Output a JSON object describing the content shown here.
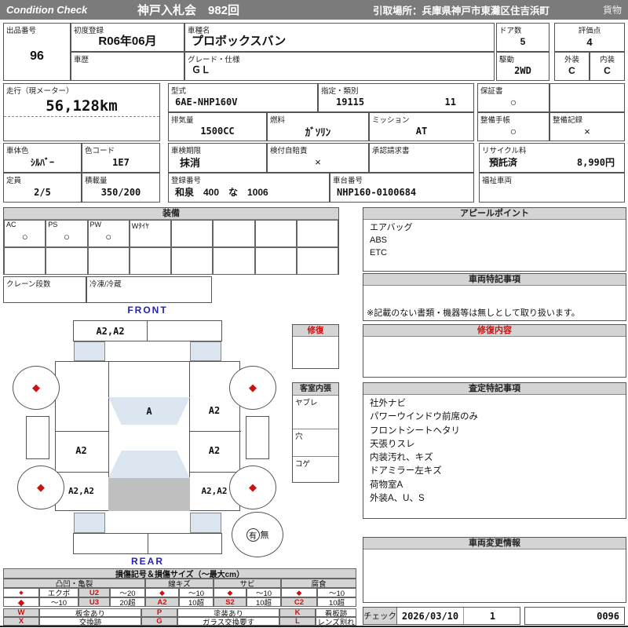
{
  "header": {
    "brand": "Condition  Check",
    "auction_title": "神戸入札会　982回",
    "pickup_location": "引取場所：兵庫県神戸市東灘区住吉浜町",
    "category": "貨物"
  },
  "info": {
    "lot_label": "出品番号",
    "lot_no": "96",
    "first_reg_label": "初度登録",
    "first_reg": "R06年06月",
    "history_label": "車歴",
    "history": "",
    "model_name_label": "車種名",
    "model_name": "プロボックスバン",
    "grade_label": "グレード・仕様",
    "grade": "ＧＬ",
    "doors_label": "ドア数",
    "doors": "5",
    "drive_label": "駆動",
    "drive": "2WD",
    "score_label": "評価点",
    "score": "4",
    "exterior_label": "外装",
    "exterior": "C",
    "interior_label": "内装",
    "interior": "C",
    "mileage_label": "走行（現メーター）",
    "mileage": "56,128km",
    "model_code_label": "型式",
    "model_code": "6AE-NHP160V",
    "class_label": "指定・類別",
    "class_no": "19115",
    "class_sub": "11",
    "warranty_label": "保証書",
    "warranty": "○",
    "displacement_label": "排気量",
    "displacement": "1500CC",
    "fuel_label": "燃料",
    "fuel": "ｶﾞｿﾘﾝ",
    "mission_label": "ミッション",
    "mission": "AT",
    "maintenance_book_label": "整備手帳",
    "maintenance_book": "○",
    "maintenance_record_label": "整備記録",
    "maintenance_record": "×",
    "body_color_label": "車体色",
    "body_color": "ｼﾙﾊﾞｰ",
    "color_code_label": "色コード",
    "color_code": "1E7",
    "inspection_label": "車検期限",
    "inspection": "抹消",
    "insurance_label": "検付自賠責",
    "insurance": "×",
    "approval_label": "承認請求書",
    "approval": "",
    "recycle_label": "リサイクル料",
    "recycle_status": "預託済",
    "recycle_fee": "8,990円",
    "capacity_label": "定員",
    "capacity": "2/5",
    "load_label": "積載量",
    "load": "350/200",
    "reg_no_label": "登録番号",
    "reg_no": "和泉　400　な　1006",
    "chassis_label": "車台番号",
    "chassis_no": "NHP160-0100684",
    "welfare_label": "福祉車両",
    "welfare": ""
  },
  "equipment": {
    "title": "装備",
    "items": [
      {
        "label": "AC",
        "value": "○"
      },
      {
        "label": "PS",
        "value": "○"
      },
      {
        "label": "PW",
        "value": "○"
      },
      {
        "label": "Wﾀｲﾔ",
        "value": ""
      },
      {
        "label": "",
        "value": ""
      },
      {
        "label": "",
        "value": ""
      },
      {
        "label": "",
        "value": ""
      },
      {
        "label": "",
        "value": ""
      }
    ],
    "crane_label": "クレーン段数",
    "crane": "",
    "reefer_label": "冷凍/冷蔵",
    "reefer": ""
  },
  "appeal": {
    "title": "アピールポイント",
    "text": "エアバッグ\nABS\nETC"
  },
  "vehicle_notes": {
    "title": "車両特記事項",
    "note": "※記載のない書類・機器等は無しとして取り扱います。"
  },
  "repair_content": {
    "title": "修復内容",
    "text": ""
  },
  "assessment": {
    "title": "査定特記事項",
    "text": "社外ナビ\nパワーウインドウ前席のみ\nフロントシートヘタリ\n天張りスレ\n内装汚れ、キズ\nドアミラー左キズ\n荷物室A\n外装A、U、S"
  },
  "change_info": {
    "title": "車両変更情報",
    "text": ""
  },
  "check": {
    "label": "チェック",
    "date": "2026/03/10",
    "count": "1",
    "sheet_no": "0096"
  },
  "diagram": {
    "front_label": "FRONT",
    "rear_label": "REAR",
    "repair_box_label": "修復",
    "interior_box": {
      "title": "客室内張",
      "rows": [
        "ヤブレ",
        "穴",
        "コゲ"
      ]
    },
    "spare": {
      "present": "有",
      "absent": "無"
    },
    "wheel_mark": "◆",
    "panels": {
      "front_bumper_left": "A2,A2",
      "windshield": "A",
      "right_fender": "A2",
      "left_door": "A2",
      "right_door": "A2",
      "left_quarter": "A2,A2",
      "right_quarter": "A2,A2"
    }
  },
  "legend": {
    "title": "損傷記号＆損傷サイズ（～最大cm）",
    "groups": [
      {
        "name": "凸凹・亀裂",
        "cells": [
          [
            "◆",
            "エクボ",
            "U2",
            "～20"
          ],
          [
            "◆",
            "～10",
            "U3",
            "20超"
          ]
        ]
      },
      {
        "name": "線キズ",
        "cells": [
          [
            "◆",
            "～10"
          ],
          [
            "A2",
            "10超"
          ]
        ]
      },
      {
        "name": "サビ",
        "cells": [
          [
            "◆",
            "～10"
          ],
          [
            "S2",
            "10超"
          ]
        ]
      },
      {
        "name": "腐食",
        "cells": [
          [
            "◆",
            "～10"
          ],
          [
            "C2",
            "10超"
          ]
        ]
      }
    ],
    "codes": [
      {
        "code": "W",
        "desc": "板金あり"
      },
      {
        "code": "X",
        "desc": "交換跡"
      },
      {
        "code": "P",
        "desc": "塗装あり"
      },
      {
        "code": "G",
        "desc": "ガラス交換要す"
      },
      {
        "code": "K",
        "desc": "看板跡"
      },
      {
        "code": "L",
        "desc": "レンズ割れ"
      }
    ]
  },
  "colors": {
    "header_bg": "#7b7b7b",
    "section_header_bg": "#d4d4d4",
    "glass_blue": "#dce6f1",
    "cargo_gray": "#bfbfbf",
    "mark_red": "#cc1111",
    "direction_blue": "#2222bb"
  }
}
